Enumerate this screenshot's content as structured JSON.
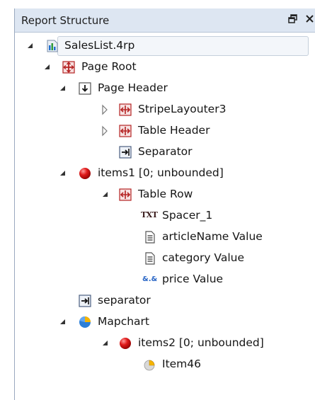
{
  "panel": {
    "title": "Report Structure"
  },
  "tree": {
    "items": [
      {
        "id": "root-file",
        "label": "SalesList.4rp",
        "icon": "report-file-icon"
      },
      {
        "id": "page-root",
        "label": "Page Root",
        "icon": "page-root-icon"
      },
      {
        "id": "page-header",
        "label": "Page Header",
        "icon": "container-down-icon"
      },
      {
        "id": "stripe",
        "label": "StripeLayouter3",
        "icon": "layouter-icon"
      },
      {
        "id": "table-header",
        "label": "Table Header",
        "icon": "layouter-icon"
      },
      {
        "id": "separator1",
        "label": "Separator",
        "icon": "separator-icon"
      },
      {
        "id": "items1",
        "label": "items1 [0; unbounded]",
        "icon": "red-ball-icon"
      },
      {
        "id": "table-row",
        "label": "Table Row",
        "icon": "layouter-icon"
      },
      {
        "id": "spacer",
        "label": "Spacer_1",
        "icon": "txt-icon",
        "icon_text": "TXT"
      },
      {
        "id": "article",
        "label": "articleName Value",
        "icon": "document-icon"
      },
      {
        "id": "category",
        "label": "category Value",
        "icon": "document-icon"
      },
      {
        "id": "price",
        "label": "price Value",
        "icon": "number-format-icon",
        "icon_text": "&.&"
      },
      {
        "id": "separator2",
        "label": "separator",
        "icon": "separator-icon"
      },
      {
        "id": "mapchart",
        "label": "Mapchart",
        "icon": "pie-chart-icon"
      },
      {
        "id": "items2",
        "label": "items2 [0; unbounded]",
        "icon": "red-ball-icon"
      },
      {
        "id": "item46",
        "label": "Item46",
        "icon": "pie-slice-icon"
      }
    ]
  }
}
